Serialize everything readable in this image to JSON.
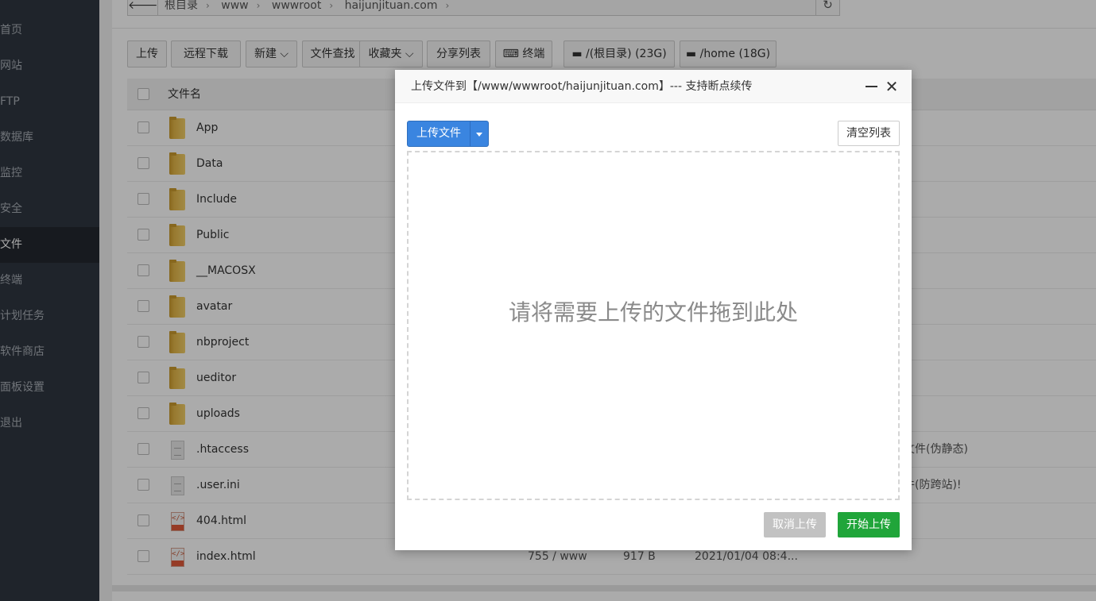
{
  "sidebar": {
    "items": [
      {
        "label": "首页"
      },
      {
        "label": "网站"
      },
      {
        "label": "FTP"
      },
      {
        "label": "数据库"
      },
      {
        "label": "监控"
      },
      {
        "label": "安全"
      },
      {
        "label": "文件"
      },
      {
        "label": "终端"
      },
      {
        "label": "计划任务"
      },
      {
        "label": "软件商店"
      },
      {
        "label": "面板设置"
      },
      {
        "label": "退出"
      }
    ],
    "active": "文件"
  },
  "pathbar": {
    "crumbs": [
      "根目录",
      "www",
      "wwwroot",
      "haijunjituan.com"
    ]
  },
  "toolbar": {
    "upload": "上传",
    "remote_download": "远程下载",
    "new": "新建",
    "file_search": "文件查找",
    "favorites": "收藏夹",
    "share_list": "分享列表",
    "terminal": "终端",
    "disk_root": "/(根目录) (23G)",
    "disk_home": "/home (18G)"
  },
  "table": {
    "header_name": "文件名",
    "rows": [
      {
        "name": "App",
        "type": "folder"
      },
      {
        "name": "Data",
        "type": "folder"
      },
      {
        "name": "Include",
        "type": "folder"
      },
      {
        "name": "Public",
        "type": "folder"
      },
      {
        "name": "__MACOSX",
        "type": "folder"
      },
      {
        "name": "avatar",
        "type": "folder"
      },
      {
        "name": "nbproject",
        "type": "folder"
      },
      {
        "name": "ueditor",
        "type": "folder"
      },
      {
        "name": "uploads",
        "type": "folder"
      },
      {
        "name": ".htaccess",
        "type": "file",
        "note": "文件(伪静态)"
      },
      {
        "name": ".user.ini",
        "type": "file",
        "note": "件(防跨站)!"
      },
      {
        "name": "404.html",
        "type": "html"
      },
      {
        "name": "index.html",
        "type": "html",
        "perm": "755 / www",
        "size": "917 B",
        "time": "2021/01/04 08:4..."
      }
    ]
  },
  "dialog": {
    "title": "上传文件到【/www/wwwroot/haijunjituan.com】--- 支持断点续传",
    "upload_button": "上传文件",
    "clear_button": "清空列表",
    "drop_hint": "请将需要上传的文件拖到此处",
    "cancel_button": "取消上传",
    "start_button": "开始上传"
  }
}
